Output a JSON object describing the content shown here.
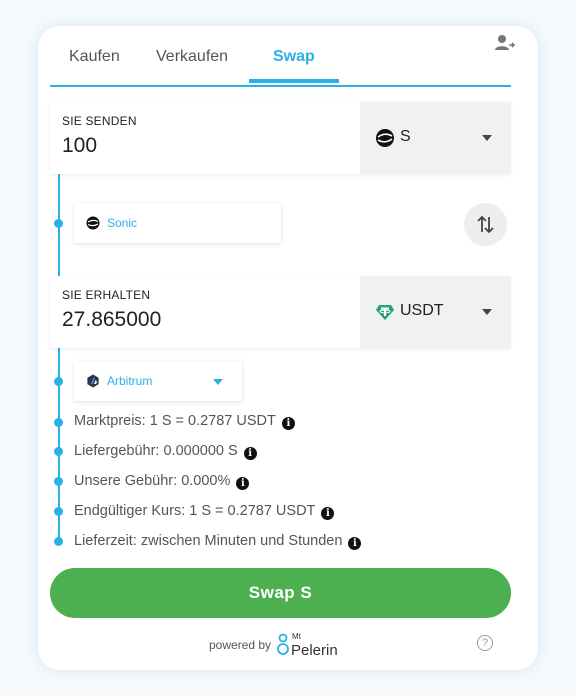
{
  "tabs": [
    {
      "label": "Kaufen"
    },
    {
      "label": "Verkaufen"
    },
    {
      "label": "Swap"
    }
  ],
  "send": {
    "label": "SIE SENDEN",
    "amount": "100",
    "currency": "S",
    "network": "Sonic"
  },
  "receive": {
    "label": "SIE ERHALTEN",
    "amount": "27.865000",
    "currency": "USDT",
    "network": "Arbitrum"
  },
  "info": [
    {
      "text": "Marktpreis: 1 S = 0.2787 USDT"
    },
    {
      "text": "Liefergebühr: 0.000000 S"
    },
    {
      "text": "Unsere Gebühr: 0.000%"
    },
    {
      "text": "Endgültiger Kurs: 1 S = 0.2787 USDT"
    },
    {
      "text": "Lieferzeit: zwischen Minuten und Stunden"
    }
  ],
  "swap_button": "Swap S",
  "footer": {
    "powered_by": "powered by",
    "brand_small": "Mt",
    "brand": "Pelerin"
  },
  "colors": {
    "accent": "#2ab0e8",
    "button": "#4caf50",
    "usdt": "#26a17b"
  },
  "icons": {
    "user": "user-switch-icon",
    "sonic": "sonic-icon",
    "usdt": "tether-icon",
    "arbitrum": "arbitrum-icon",
    "swap": "swap-arrows-icon",
    "info": "info-icon",
    "help": "help-icon"
  }
}
